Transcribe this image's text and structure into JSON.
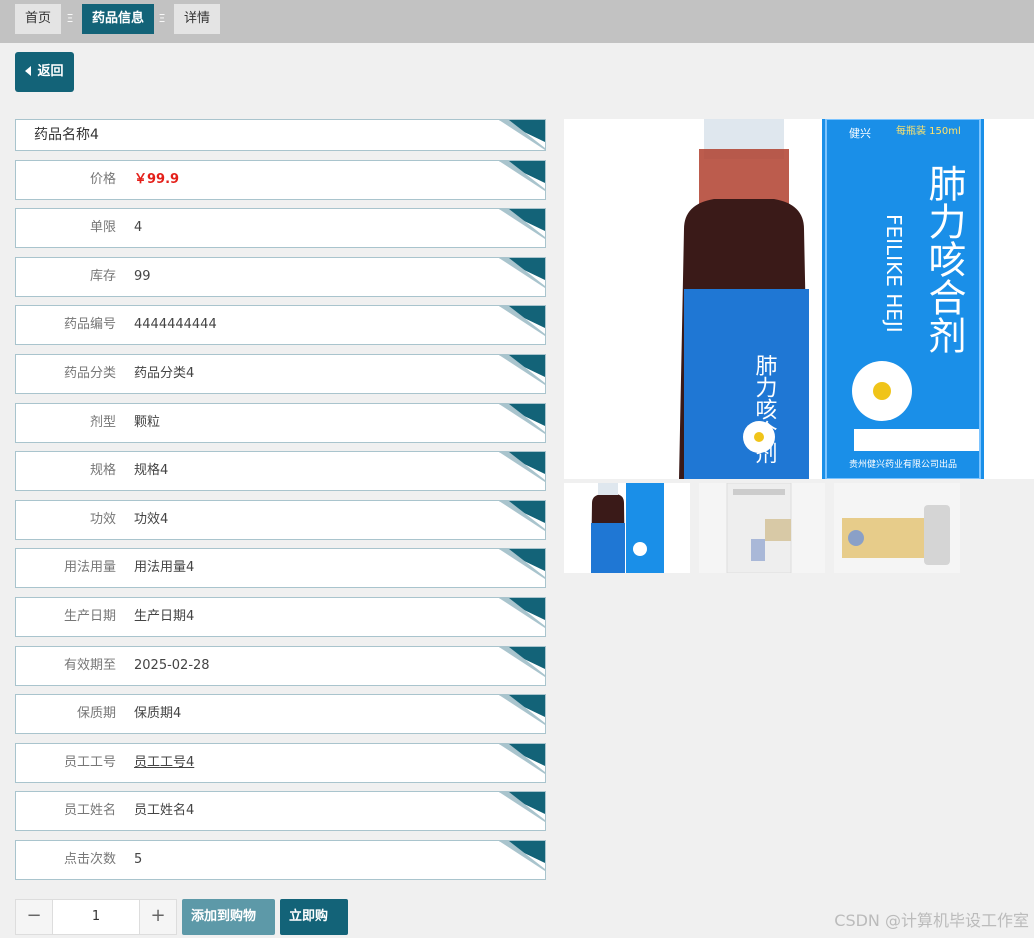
{
  "breadcrumb": {
    "items": [
      "首页",
      "药品信息",
      "详情"
    ],
    "separator": "Ξ"
  },
  "back_label": "返回",
  "drug_name": "药品名称4",
  "fields": [
    {
      "label": "价格",
      "value": "￥99.9",
      "kind": "price"
    },
    {
      "label": "单限",
      "value": "4"
    },
    {
      "label": "库存",
      "value": "99"
    },
    {
      "label": "药品编号",
      "value": "4444444444"
    },
    {
      "label": "药品分类",
      "value": "药品分类4"
    },
    {
      "label": "剂型",
      "value": "颗粒"
    },
    {
      "label": "规格",
      "value": "规格4"
    },
    {
      "label": "功效",
      "value": "功效4"
    },
    {
      "label": "用法用量",
      "value": "用法用量4"
    },
    {
      "label": "生产日期",
      "value": "生产日期4"
    },
    {
      "label": "有效期至",
      "value": "2025-02-28"
    },
    {
      "label": "保质期",
      "value": "保质期4"
    },
    {
      "label": "员工工号",
      "value": "员工工号4",
      "kind": "link"
    },
    {
      "label": "员工姓名",
      "value": "员工姓名4"
    },
    {
      "label": "点击次数",
      "value": "5"
    }
  ],
  "product_image": {
    "brand": "健兴",
    "capacity": "每瓶装 150ml",
    "name": "肺力咳合剂",
    "pinyin": "FEILIKE HEJI",
    "maker": "贵州健兴药业有限公司出品"
  },
  "quantity": {
    "minus": "−",
    "value": "1",
    "plus": "+"
  },
  "actions": {
    "add_to_cart": "添加到购物车",
    "buy_now": "立即购买"
  },
  "watermark": "CSDN @计算机毕设工作室",
  "colors": {
    "accent": "#136378",
    "accent_light": "#5d99a8",
    "price": "#e4201a"
  }
}
